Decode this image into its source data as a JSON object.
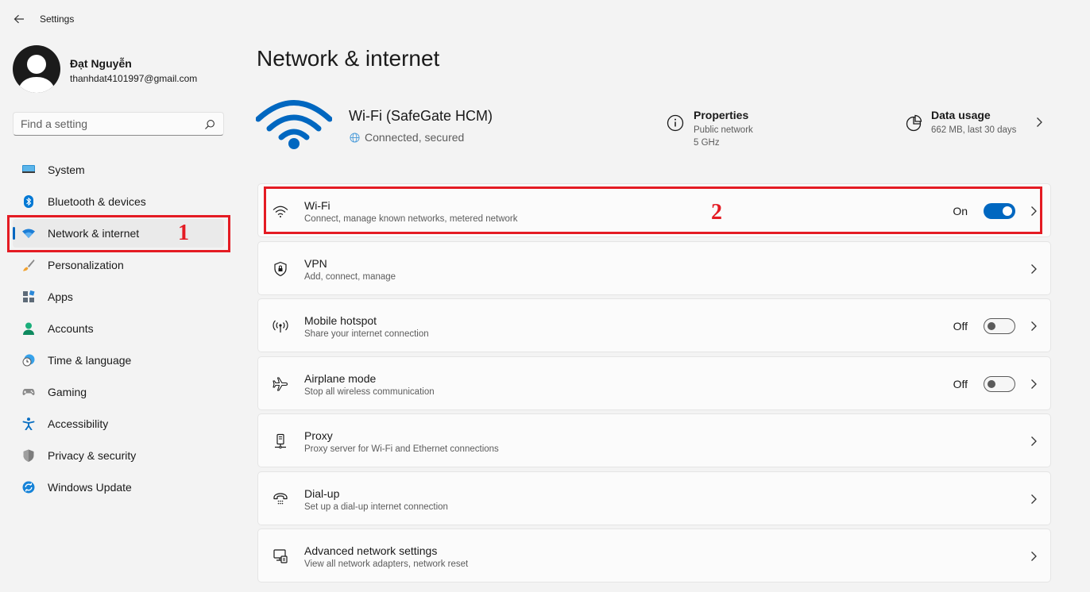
{
  "window": {
    "title": "Settings"
  },
  "user": {
    "name": "Đạt Nguyễn",
    "email": "thanhdat4101997@gmail.com"
  },
  "search": {
    "placeholder": "Find a setting"
  },
  "sidebar": {
    "items": [
      {
        "label": "System",
        "icon": "system-icon"
      },
      {
        "label": "Bluetooth & devices",
        "icon": "bluetooth-icon"
      },
      {
        "label": "Network & internet",
        "icon": "network-icon",
        "selected": true
      },
      {
        "label": "Personalization",
        "icon": "brush-icon"
      },
      {
        "label": "Apps",
        "icon": "apps-icon"
      },
      {
        "label": "Accounts",
        "icon": "accounts-icon"
      },
      {
        "label": "Time & language",
        "icon": "time-language-icon"
      },
      {
        "label": "Gaming",
        "icon": "gamepad-icon"
      },
      {
        "label": "Accessibility",
        "icon": "accessibility-icon"
      },
      {
        "label": "Privacy & security",
        "icon": "shield-icon"
      },
      {
        "label": "Windows Update",
        "icon": "update-icon"
      }
    ]
  },
  "annotations": {
    "first": "1",
    "second": "2",
    "color": "#e41b23"
  },
  "main": {
    "title": "Network & internet",
    "hero": {
      "name": "Wi-Fi (SafeGate HCM)",
      "status": "Connected, secured"
    },
    "properties": {
      "title": "Properties",
      "line1": "Public network",
      "line2": "5 GHz"
    },
    "data_usage": {
      "title": "Data usage",
      "line1": "662 MB, last 30 days"
    },
    "cards": [
      {
        "title": "Wi-Fi",
        "subtitle": "Connect, manage known networks, metered network",
        "toggle": "On",
        "icon": "wifi-icon"
      },
      {
        "title": "VPN",
        "subtitle": "Add, connect, manage",
        "icon": "vpn-shield-icon"
      },
      {
        "title": "Mobile hotspot",
        "subtitle": "Share your internet connection",
        "toggle": "Off",
        "icon": "hotspot-icon"
      },
      {
        "title": "Airplane mode",
        "subtitle": "Stop all wireless communication",
        "toggle": "Off",
        "icon": "airplane-icon"
      },
      {
        "title": "Proxy",
        "subtitle": "Proxy server for Wi-Fi and Ethernet connections",
        "icon": "proxy-icon"
      },
      {
        "title": "Dial-up",
        "subtitle": "Set up a dial-up internet connection",
        "icon": "dialup-icon"
      },
      {
        "title": "Advanced network settings",
        "subtitle": "View all network adapters, network reset",
        "icon": "advanced-network-icon"
      }
    ]
  },
  "colors": {
    "accent": "#0067c0",
    "background": "#f3f3f3",
    "card": "#fbfbfb"
  }
}
